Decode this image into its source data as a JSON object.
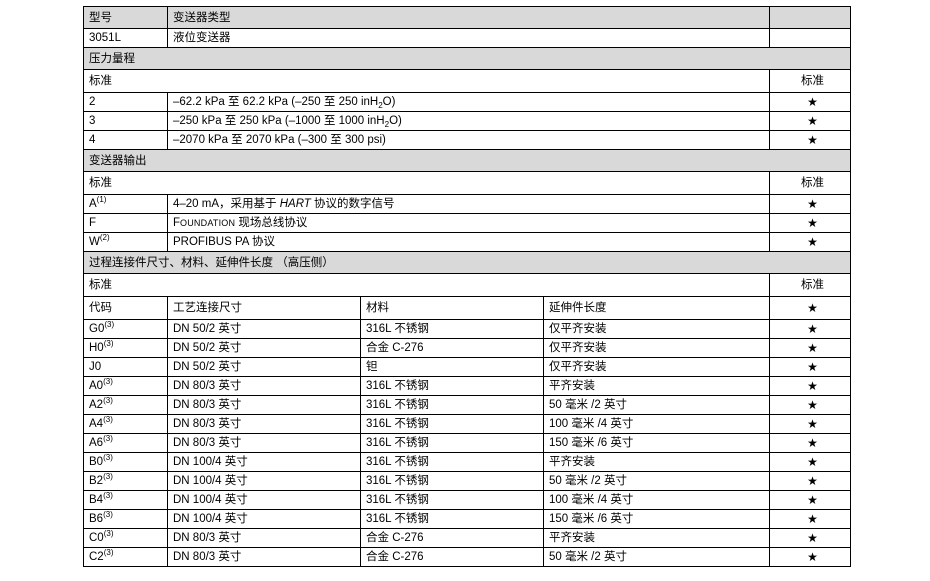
{
  "header_row": {
    "model": "型号",
    "type": "变送器类型"
  },
  "model_row": {
    "code": "3051L",
    "desc": "液位变送器"
  },
  "pressure": {
    "title": "压力量程",
    "standard_label": "标准",
    "standard_right": "标准",
    "rows": [
      {
        "code": "2",
        "desc_pre": "–62.2 kPa 至 62.2 kPa (–250 至 250 inH",
        "desc_sub": "2",
        "desc_post": "O)",
        "mark": "★"
      },
      {
        "code": "3",
        "desc_pre": "–250 kPa 至 250 kPa (–1000 至 1000 inH",
        "desc_sub": "2",
        "desc_post": "O)",
        "mark": "★"
      },
      {
        "code": "4",
        "desc": "–2070 kPa 至 2070 kPa (–300 至 300 psi)",
        "mark": "★"
      }
    ]
  },
  "output": {
    "title": "变送器输出",
    "standard_label": "标准",
    "standard_right": "标准",
    "rows": [
      {
        "code": "A",
        "note": "(1)",
        "desc_pre": "4–20 mA，采用基于 ",
        "desc_italic": "HART",
        "desc_post": " 协议的数字信号",
        "mark": "★"
      },
      {
        "code": "F",
        "desc_first": "F",
        "desc_smallcaps": "OUNDATION",
        "desc_post": " 现场总线协议",
        "mark": "★"
      },
      {
        "code": "W",
        "note": "(2)",
        "desc": "PROFIBUS PA 协议",
        "mark": "★"
      }
    ]
  },
  "process": {
    "title": "过程连接件尺寸、材料、延伸件长度 （高压侧）",
    "standard_label": "标准",
    "standard_right": "标准",
    "headers": {
      "code": "代码",
      "size": "工艺连接尺寸",
      "material": "材料",
      "extension": "延伸件长度",
      "mark": "★"
    },
    "rows": [
      {
        "code": "G0",
        "note": "(3)",
        "size": "DN 50/2 英寸",
        "material": "316L 不锈钢",
        "extension": "仅平齐安装",
        "mark": "★"
      },
      {
        "code": "H0",
        "note": "(3)",
        "size": "DN 50/2 英寸",
        "material": "合金 C-276",
        "extension": "仅平齐安装",
        "mark": "★"
      },
      {
        "code": "J0",
        "size": "DN 50/2 英寸",
        "material": "钽",
        "extension": "仅平齐安装",
        "mark": "★"
      },
      {
        "code": "A0",
        "note": "(3)",
        "size": "DN 80/3 英寸",
        "material": "316L 不锈钢",
        "extension": "平齐安装",
        "mark": "★"
      },
      {
        "code": "A2",
        "note": "(3)",
        "size": "DN 80/3 英寸",
        "material": "316L 不锈钢",
        "extension": "50 毫米 /2 英寸",
        "mark": "★"
      },
      {
        "code": "A4",
        "note": "(3)",
        "size": "DN 80/3 英寸",
        "material": "316L 不锈钢",
        "extension": "100 毫米 /4 英寸",
        "mark": "★"
      },
      {
        "code": "A6",
        "note": "(3)",
        "size": "DN 80/3 英寸",
        "material": "316L 不锈钢",
        "extension": "150 毫米 /6 英寸",
        "mark": "★"
      },
      {
        "code": "B0",
        "note": "(3)",
        "size": "DN 100/4 英寸",
        "material": "316L 不锈钢",
        "extension": "平齐安装",
        "mark": "★"
      },
      {
        "code": "B2",
        "note": "(3)",
        "size": "DN 100/4 英寸",
        "material": "316L 不锈钢",
        "extension": "50 毫米 /2 英寸",
        "mark": "★"
      },
      {
        "code": "B4",
        "note": "(3)",
        "size": "DN 100/4 英寸",
        "material": "316L 不锈钢",
        "extension": "100 毫米 /4 英寸",
        "mark": "★"
      },
      {
        "code": "B6",
        "note": "(3)",
        "size": "DN 100/4 英寸",
        "material": "316L 不锈钢",
        "extension": "150 毫米 /6 英寸",
        "mark": "★"
      },
      {
        "code": "C0",
        "note": "(3)",
        "size": "DN 80/3 英寸",
        "material": "合金 C-276",
        "extension": "平齐安装",
        "mark": "★"
      },
      {
        "code": "C2",
        "note": "(3)",
        "size": "DN 80/3 英寸",
        "material": "合金 C-276",
        "extension": "50 毫米 /2 英寸",
        "mark": "★"
      }
    ]
  }
}
